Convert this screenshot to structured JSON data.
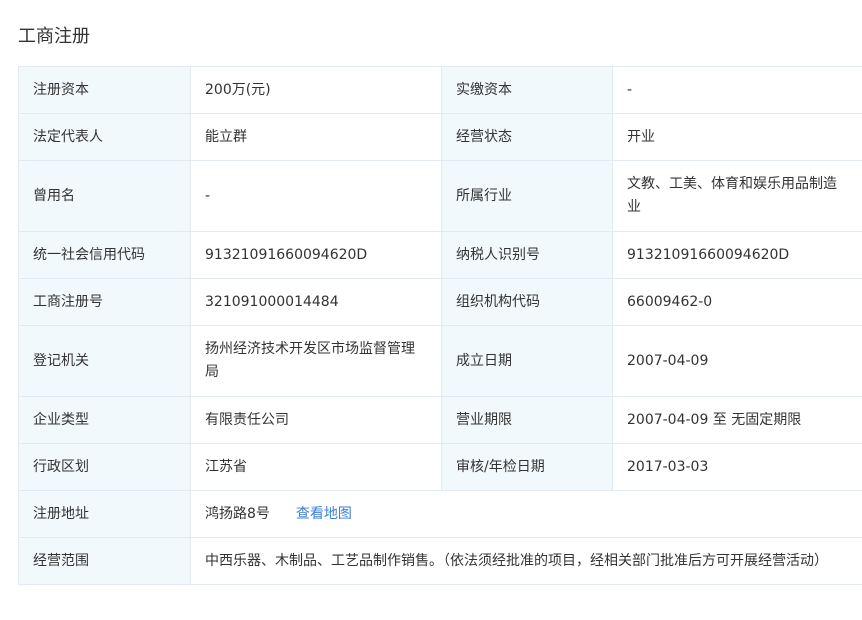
{
  "section_title": "工商注册",
  "rows": [
    {
      "label1": "注册资本",
      "value1": "200万(元)",
      "label2": "实缴资本",
      "value2": "-"
    },
    {
      "label1": "法定代表人",
      "value1": "能立群",
      "label2": "经营状态",
      "value2": "开业"
    },
    {
      "label1": "曾用名",
      "value1": "-",
      "label2": "所属行业",
      "value2": "文教、工美、体育和娱乐用品制造业"
    },
    {
      "label1": "统一社会信用代码",
      "value1": "91321091660094620D",
      "label2": "纳税人识别号",
      "value2": "91321091660094620D"
    },
    {
      "label1": "工商注册号",
      "value1": "321091000014484",
      "label2": "组织机构代码",
      "value2": "66009462-0"
    },
    {
      "label1": "登记机关",
      "value1": "扬州经济技术开发区市场监督管理局",
      "label2": "成立日期",
      "value2": "2007-04-09"
    },
    {
      "label1": "企业类型",
      "value1": "有限责任公司",
      "label2": "营业期限",
      "value2": "2007-04-09 至 无固定期限"
    },
    {
      "label1": "行政区划",
      "value1": "江苏省",
      "label2": "审核/年检日期",
      "value2": "2017-03-03"
    }
  ],
  "address": {
    "label": "注册地址",
    "value": "鸿扬路8号",
    "map_link": "查看地图"
  },
  "scope": {
    "label": "经营范围",
    "value": "中西乐器、木制品、工艺品制作销售。（依法须经批准的项目，经相关部门批准后方可开展经营活动）"
  }
}
